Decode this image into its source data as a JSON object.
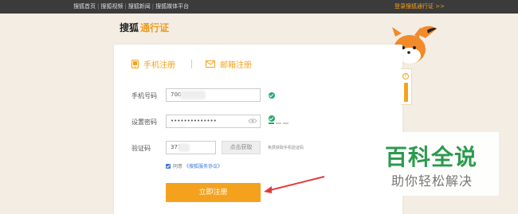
{
  "topbar": {
    "links": [
      "搜狐首页",
      "搜狐视频",
      "搜狐新闻",
      "搜狐媒体平台"
    ],
    "login": "登录搜狐通行证 >>"
  },
  "brand": {
    "name": "搜狐",
    "pass": "通行证"
  },
  "tabs": {
    "phone": "手机注册",
    "email": "邮箱注册"
  },
  "form": {
    "phone_label": "手机号码",
    "phone_value": "700",
    "password_label": "设置密码",
    "password_value": "••••••••••••••",
    "code_label": "验证码",
    "code_value": "377",
    "code_button": "点击获取",
    "code_tip": "免费获取手机验证码",
    "agree_text": "同意",
    "agree_link": "《搜狐服务协议》",
    "submit": "立即注册"
  },
  "watermark": {
    "title": "百科全说",
    "subtitle": "助你轻松解决"
  },
  "colors": {
    "accent": "#f4a21d",
    "ok": "#2aa86f",
    "link": "#3b79d8",
    "watermark": "#2c9a4e"
  },
  "icons": [
    "phone-icon",
    "mail-icon",
    "eye-icon",
    "check-icon",
    "fox-mascot",
    "help-icon"
  ]
}
